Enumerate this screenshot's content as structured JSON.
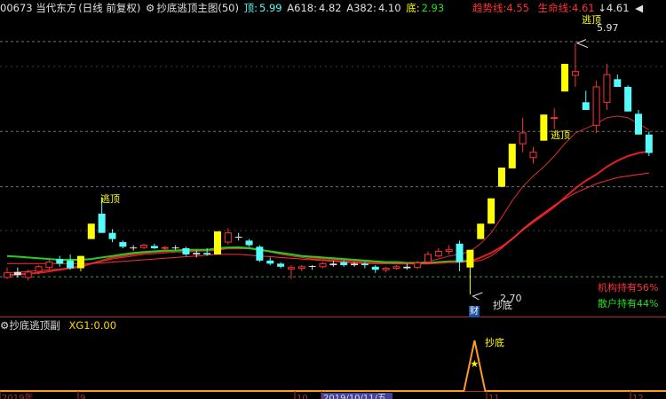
{
  "header": {
    "code_name": "00673 当代东方",
    "period": "(日线 前复权)",
    "indicator": "抄底逃顶主图(50)",
    "top_label": "顶:",
    "top_value": "5.99",
    "a618_label": "A618:",
    "a618_value": "4.82",
    "a382_label": "A382:",
    "a382_value": "4.10",
    "bottom_label": "底:",
    "bottom_value": "2.93",
    "trend_label": "趋势线:",
    "trend_value": "4.55",
    "life_label": "生命线:",
    "life_value": "4.61",
    "arrow_value": "4.61"
  },
  "sub_header": {
    "indicator": "抄底逃顶副",
    "xg_label": "XG1:",
    "xg_value": "0.00"
  },
  "annotations": {
    "escape_top_1": "逃顶",
    "escape_top_2": "逃顶",
    "escape_top_3": "逃顶",
    "buy_bottom": "抄底",
    "sub_buy_bottom": "抄底",
    "high_price": "5.97",
    "low_price": "2.70",
    "institution_hold": "机构持有56%",
    "retail_hold": "散户持有44%",
    "fin_badge": "财"
  },
  "time_axis": {
    "labels": [
      "2019年",
      "9",
      "10",
      "2019/10/11/五",
      "11",
      "12"
    ]
  },
  "colors": {
    "up": "#ff3232",
    "down": "#54fcfc",
    "white": "#e0e0e0",
    "yellow_bar": "#ffff00",
    "trend": "#ff2020",
    "life": "#ff4040",
    "green_line": "#20c020",
    "dash": "#6c6c6c"
  },
  "chart_data": {
    "type": "candlestick",
    "price_range": [
      2.55,
      6.3
    ],
    "candles": [
      {
        "o": 2.98,
        "h": 3.05,
        "l": 2.9,
        "c": 2.92,
        "col": "up"
      },
      {
        "o": 2.95,
        "h": 3.05,
        "l": 2.92,
        "c": 2.99,
        "col": "white"
      },
      {
        "o": 2.92,
        "h": 3.02,
        "l": 2.88,
        "c": 2.99,
        "col": "up"
      },
      {
        "o": 3.0,
        "h": 3.08,
        "l": 2.96,
        "c": 3.06,
        "col": "up"
      },
      {
        "o": 3.05,
        "h": 3.15,
        "l": 3.02,
        "c": 3.12,
        "col": "up"
      },
      {
        "o": 3.1,
        "h": 3.2,
        "l": 3.06,
        "c": 3.16,
        "col": "down"
      },
      {
        "o": 3.14,
        "h": 3.22,
        "l": 3.02,
        "c": 3.04,
        "col": "down"
      },
      {
        "o": 3.04,
        "h": 3.2,
        "l": 3.0,
        "c": 3.2,
        "col": "yellow"
      },
      {
        "o": 3.42,
        "h": 3.62,
        "l": 3.42,
        "c": 3.62,
        "col": "yellow"
      },
      {
        "o": 3.75,
        "h": 3.96,
        "l": 3.5,
        "c": 3.5,
        "col": "down"
      },
      {
        "o": 3.5,
        "h": 3.55,
        "l": 3.38,
        "c": 3.42,
        "col": "down"
      },
      {
        "o": 3.38,
        "h": 3.4,
        "l": 3.3,
        "c": 3.32,
        "col": "down"
      },
      {
        "o": 3.3,
        "h": 3.34,
        "l": 3.27,
        "c": 3.31,
        "col": "white"
      },
      {
        "o": 3.31,
        "h": 3.36,
        "l": 3.29,
        "c": 3.34,
        "col": "up"
      },
      {
        "o": 3.33,
        "h": 3.36,
        "l": 3.29,
        "c": 3.3,
        "col": "down"
      },
      {
        "o": 3.3,
        "h": 3.33,
        "l": 3.27,
        "c": 3.31,
        "col": "up"
      },
      {
        "o": 3.3,
        "h": 3.34,
        "l": 3.28,
        "c": 3.31,
        "col": "white"
      },
      {
        "o": 3.3,
        "h": 3.32,
        "l": 3.2,
        "c": 3.22,
        "col": "down"
      },
      {
        "o": 3.22,
        "h": 3.27,
        "l": 3.18,
        "c": 3.24,
        "col": "white"
      },
      {
        "o": 3.24,
        "h": 3.3,
        "l": 3.2,
        "c": 3.22,
        "col": "down"
      },
      {
        "o": 3.22,
        "h": 3.52,
        "l": 3.22,
        "c": 3.52,
        "col": "yellow"
      },
      {
        "o": 3.38,
        "h": 3.56,
        "l": 3.35,
        "c": 3.5,
        "col": "up"
      },
      {
        "o": 3.44,
        "h": 3.5,
        "l": 3.4,
        "c": 3.45,
        "col": "white"
      },
      {
        "o": 3.4,
        "h": 3.42,
        "l": 3.32,
        "c": 3.34,
        "col": "down"
      },
      {
        "o": 3.32,
        "h": 3.34,
        "l": 3.12,
        "c": 3.14,
        "col": "down"
      },
      {
        "o": 3.14,
        "h": 3.18,
        "l": 3.08,
        "c": 3.1,
        "col": "down"
      },
      {
        "o": 3.1,
        "h": 3.12,
        "l": 3.04,
        "c": 3.06,
        "col": "down"
      },
      {
        "o": 3.05,
        "h": 3.08,
        "l": 2.9,
        "c": 3.03,
        "col": "up"
      },
      {
        "o": 3.04,
        "h": 3.08,
        "l": 3.0,
        "c": 3.06,
        "col": "up"
      },
      {
        "o": 3.06,
        "h": 3.08,
        "l": 3.02,
        "c": 3.07,
        "col": "white"
      },
      {
        "o": 3.06,
        "h": 3.12,
        "l": 3.04,
        "c": 3.1,
        "col": "up"
      },
      {
        "o": 3.1,
        "h": 3.14,
        "l": 3.06,
        "c": 3.08,
        "col": "white"
      },
      {
        "o": 3.08,
        "h": 3.14,
        "l": 3.06,
        "c": 3.12,
        "col": "down"
      },
      {
        "o": 3.1,
        "h": 3.12,
        "l": 3.06,
        "c": 3.08,
        "col": "white"
      },
      {
        "o": 3.08,
        "h": 3.12,
        "l": 3.04,
        "c": 3.1,
        "col": "down"
      },
      {
        "o": 3.06,
        "h": 3.08,
        "l": 2.98,
        "c": 3.02,
        "col": "down"
      },
      {
        "o": 3.02,
        "h": 3.06,
        "l": 2.99,
        "c": 3.04,
        "col": "up"
      },
      {
        "o": 3.04,
        "h": 3.08,
        "l": 3.02,
        "c": 3.06,
        "col": "up"
      },
      {
        "o": 3.04,
        "h": 3.1,
        "l": 3.02,
        "c": 3.06,
        "col": "white"
      },
      {
        "o": 3.05,
        "h": 3.14,
        "l": 3.03,
        "c": 3.11,
        "col": "up"
      },
      {
        "o": 3.12,
        "h": 3.26,
        "l": 3.1,
        "c": 3.22,
        "col": "up"
      },
      {
        "o": 3.2,
        "h": 3.3,
        "l": 3.18,
        "c": 3.26,
        "col": "up"
      },
      {
        "o": 3.26,
        "h": 3.34,
        "l": 3.22,
        "c": 3.28,
        "col": "up"
      },
      {
        "o": 3.36,
        "h": 3.4,
        "l": 3.0,
        "c": 3.12,
        "col": "down"
      },
      {
        "o": 3.05,
        "h": 3.28,
        "l": 2.7,
        "c": 3.28,
        "col": "yellow"
      },
      {
        "o": 3.42,
        "h": 3.62,
        "l": 3.42,
        "c": 3.62,
        "col": "yellow"
      },
      {
        "o": 3.62,
        "h": 3.95,
        "l": 3.62,
        "c": 3.95,
        "col": "yellow"
      },
      {
        "o": 4.1,
        "h": 4.35,
        "l": 4.1,
        "c": 4.35,
        "col": "yellow"
      },
      {
        "o": 4.34,
        "h": 4.66,
        "l": 4.34,
        "c": 4.66,
        "col": "yellow"
      },
      {
        "o": 4.66,
        "h": 5.0,
        "l": 4.55,
        "c": 4.8,
        "col": "up"
      },
      {
        "o": 4.48,
        "h": 4.62,
        "l": 4.4,
        "c": 4.55,
        "col": "up"
      },
      {
        "o": 4.7,
        "h": 5.04,
        "l": 4.7,
        "c": 5.04,
        "col": "yellow"
      },
      {
        "o": 5.0,
        "h": 5.12,
        "l": 4.85,
        "c": 5.0,
        "col": "up"
      },
      {
        "o": 5.34,
        "h": 5.7,
        "l": 5.34,
        "c": 5.7,
        "col": "yellow"
      },
      {
        "o": 5.6,
        "h": 5.97,
        "l": 5.4,
        "c": 5.55,
        "col": "up"
      },
      {
        "o": 5.2,
        "h": 5.35,
        "l": 5.1,
        "c": 5.1,
        "col": "down"
      },
      {
        "o": 4.9,
        "h": 5.48,
        "l": 4.8,
        "c": 5.4,
        "col": "up"
      },
      {
        "o": 5.2,
        "h": 5.7,
        "l": 5.1,
        "c": 5.56,
        "col": "up"
      },
      {
        "o": 5.5,
        "h": 5.56,
        "l": 5.4,
        "c": 5.4,
        "col": "down"
      },
      {
        "o": 5.4,
        "h": 5.42,
        "l": 5.08,
        "c": 5.08,
        "col": "down"
      },
      {
        "o": 5.05,
        "h": 5.1,
        "l": 4.78,
        "c": 4.78,
        "col": "down"
      },
      {
        "o": 4.78,
        "h": 4.82,
        "l": 4.5,
        "c": 4.54,
        "col": "down"
      }
    ],
    "series": [
      {
        "name": "趋势线",
        "values": [
          2.95,
          2.96,
          2.97,
          2.98,
          3.0,
          3.02,
          3.04,
          3.06,
          3.1,
          3.14,
          3.18,
          3.2,
          3.22,
          3.24,
          3.25,
          3.26,
          3.27,
          3.27,
          3.27,
          3.27,
          3.28,
          3.3,
          3.3,
          3.3,
          3.28,
          3.26,
          3.24,
          3.22,
          3.2,
          3.18,
          3.17,
          3.16,
          3.15,
          3.14,
          3.13,
          3.12,
          3.11,
          3.1,
          3.1,
          3.1,
          3.1,
          3.11,
          3.12,
          3.12,
          3.13,
          3.18,
          3.24,
          3.32,
          3.42,
          3.54,
          3.64,
          3.74,
          3.84,
          3.96,
          4.08,
          4.18,
          4.26,
          4.36,
          4.44,
          4.5,
          4.54,
          4.56
        ]
      },
      {
        "name": "生命线",
        "values": [
          2.98,
          2.99,
          3.0,
          3.01,
          3.02,
          3.03,
          3.05,
          3.07,
          3.1,
          3.13,
          3.16,
          3.18,
          3.2,
          3.22,
          3.23,
          3.24,
          3.25,
          3.25,
          3.26,
          3.27,
          3.28,
          3.31,
          3.32,
          3.31,
          3.28,
          3.25,
          3.22,
          3.2,
          3.18,
          3.16,
          3.15,
          3.14,
          3.13,
          3.12,
          3.11,
          3.1,
          3.1,
          3.1,
          3.1,
          3.11,
          3.13,
          3.16,
          3.2,
          3.22,
          3.26,
          3.36,
          3.5,
          3.7,
          3.92,
          4.1,
          4.24,
          4.36,
          4.5,
          4.66,
          4.8,
          4.86,
          4.92,
          5.0,
          5.02,
          5.0,
          4.92,
          4.84
        ]
      },
      {
        "name": "green",
        "values": [
          3.2,
          3.19,
          3.18,
          3.17,
          3.16,
          3.15,
          3.15,
          3.15,
          3.16,
          3.18,
          3.2,
          3.22,
          3.24,
          3.25,
          3.26,
          3.27,
          3.27,
          3.28,
          3.28,
          3.28,
          3.3,
          3.31,
          3.31,
          3.3,
          3.28,
          3.26,
          3.24,
          3.22,
          3.2,
          3.19,
          3.18,
          3.17,
          3.16,
          3.15,
          3.14,
          3.13,
          3.12,
          3.12,
          3.11,
          3.11,
          3.11,
          3.12,
          3.13,
          3.13,
          3.14
        ]
      },
      {
        "name": "bottom",
        "values": [
          3.1,
          3.1,
          3.1,
          3.1,
          3.1,
          3.1,
          3.1,
          3.1,
          3.1,
          3.11,
          3.12,
          3.13,
          3.14,
          3.15,
          3.16,
          3.17,
          3.18,
          3.19,
          3.2,
          3.21,
          3.22,
          3.22,
          3.22,
          3.21,
          3.2,
          3.19,
          3.18,
          3.17,
          3.16,
          3.15,
          3.14,
          3.13,
          3.12,
          3.11,
          3.1,
          3.1,
          3.1,
          3.1,
          3.1,
          3.1,
          3.1,
          3.11,
          3.12,
          3.12,
          3.13,
          3.14,
          3.2,
          3.3,
          3.42,
          3.55,
          3.66,
          3.76,
          3.86,
          3.94,
          4.02,
          4.08,
          4.14,
          4.18,
          4.22,
          4.24,
          4.26,
          4.28
        ]
      }
    ],
    "ref_lines": [
      5.99,
      4.82,
      4.1,
      2.93
    ]
  }
}
